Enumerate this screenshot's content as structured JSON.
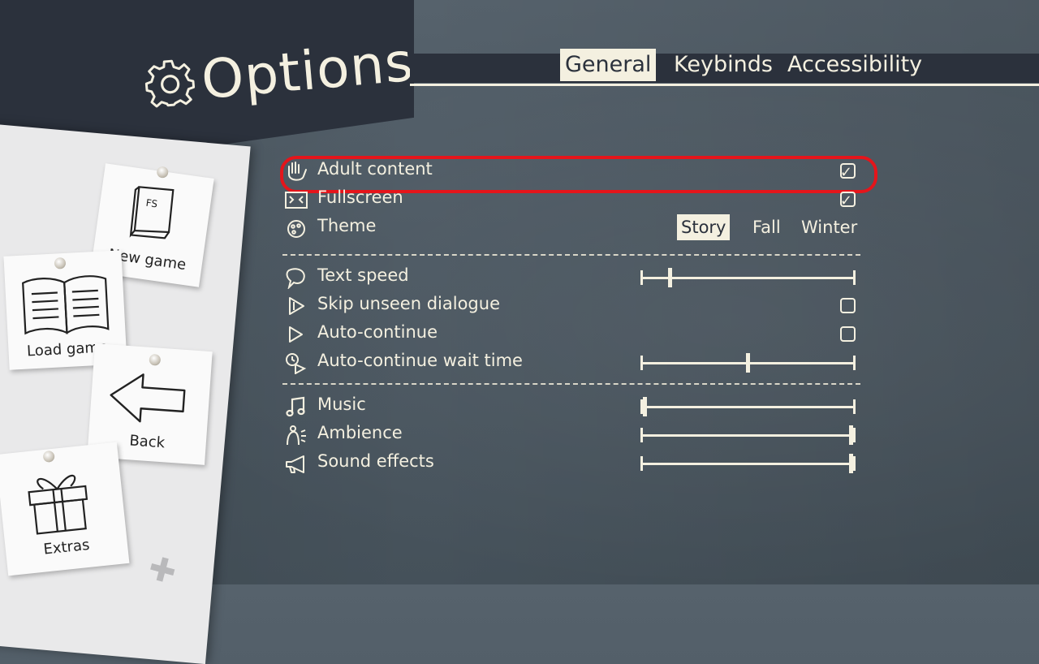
{
  "header": {
    "title": "Options",
    "icon": "gear-icon"
  },
  "tabs": [
    {
      "label": "General",
      "active": true
    },
    {
      "label": "Keybinds",
      "active": false
    },
    {
      "label": "Accessibility",
      "active": false
    }
  ],
  "sidebar": {
    "notes": [
      {
        "label": "New game",
        "icon": "book-icon",
        "icon_text": "FS"
      },
      {
        "label": "Load game",
        "icon": "open-book-icon"
      },
      {
        "label": "Back",
        "icon": "left-arrow-icon"
      },
      {
        "label": "Extras",
        "icon": "gift-icon"
      }
    ],
    "plus_icon": "plus-icon"
  },
  "options": {
    "adult_content": {
      "label": "Adult content",
      "icon": "hand-icon",
      "checked": true,
      "highlighted": true
    },
    "fullscreen": {
      "label": "Fullscreen",
      "icon": "fullscreen-icon",
      "checked": true
    },
    "theme": {
      "label": "Theme",
      "icon": "palette-icon",
      "choices": [
        "Story",
        "Fall",
        "Winter"
      ],
      "selected": "Story"
    },
    "text_speed": {
      "label": "Text speed",
      "icon": "speech-icon",
      "value_fraction": 0.13
    },
    "skip_unseen": {
      "label": "Skip unseen dialogue",
      "icon": "fast-forward-icon",
      "checked": false
    },
    "auto_continue": {
      "label": "Auto-continue",
      "icon": "play-icon",
      "checked": false
    },
    "auto_wait": {
      "label": "Auto-continue wait time",
      "icon": "timer-play-icon",
      "value_fraction": 0.5
    },
    "music": {
      "label": "Music",
      "icon": "music-note-icon",
      "value_fraction": 0.01
    },
    "ambience": {
      "label": "Ambience",
      "icon": "ambience-icon",
      "value_fraction": 0.99
    },
    "sound_effects": {
      "label": "Sound effects",
      "icon": "megaphone-icon",
      "value_fraction": 0.99
    }
  },
  "colors": {
    "accent": "#f4f0e0",
    "panel": "#2b313c",
    "highlight": "#e5151b"
  }
}
